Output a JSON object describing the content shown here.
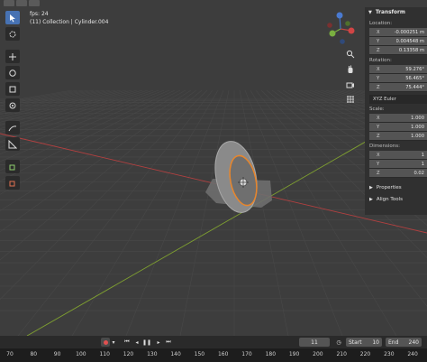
{
  "overlay": {
    "fps": "fps: 24",
    "collection": "(11) Collection | Cylinder.004"
  },
  "toolbar": {
    "tools": [
      "select-box",
      "cursor",
      "move",
      "rotate",
      "scale",
      "transform",
      "annotate",
      "measure",
      "add-cube",
      "add-cube-cursor"
    ]
  },
  "npanel": {
    "transform_title": "Transform",
    "location_label": "Location:",
    "location": [
      {
        "axis": "X",
        "value": "-0.000251 m"
      },
      {
        "axis": "Y",
        "value": "0.004548 m"
      },
      {
        "axis": "Z",
        "value": "0.13358 m"
      }
    ],
    "rotation_label": "Rotation:",
    "rotation": [
      {
        "axis": "X",
        "value": "59.276°"
      },
      {
        "axis": "Y",
        "value": "56.465°"
      },
      {
        "axis": "Z",
        "value": "75.444°"
      }
    ],
    "rotation_mode": "XYZ Euler",
    "scale_label": "Scale:",
    "scale": [
      {
        "axis": "X",
        "value": "1.000"
      },
      {
        "axis": "Y",
        "value": "1.000"
      },
      {
        "axis": "Z",
        "value": "1.000"
      }
    ],
    "dimensions_label": "Dimensions:",
    "dimensions": [
      {
        "axis": "X",
        "value": "1"
      },
      {
        "axis": "Y",
        "value": "1"
      },
      {
        "axis": "Z",
        "value": "0.02"
      }
    ],
    "properties_label": "Properties",
    "align_tools_label": "Align Tools"
  },
  "timeline": {
    "current_frame": "11",
    "start_label": "Start",
    "start": "10",
    "end_label": "End",
    "end": "240",
    "ruler_ticks": [
      "70",
      "80",
      "90",
      "100",
      "110",
      "120",
      "130",
      "140",
      "150",
      "160",
      "170",
      "180",
      "190",
      "200",
      "210",
      "220",
      "230",
      "240"
    ]
  },
  "colors": {
    "x_axis": "#b34040",
    "y_axis": "#7fa030",
    "selection_outline": "#e8862c",
    "accent": "#4772b3"
  }
}
